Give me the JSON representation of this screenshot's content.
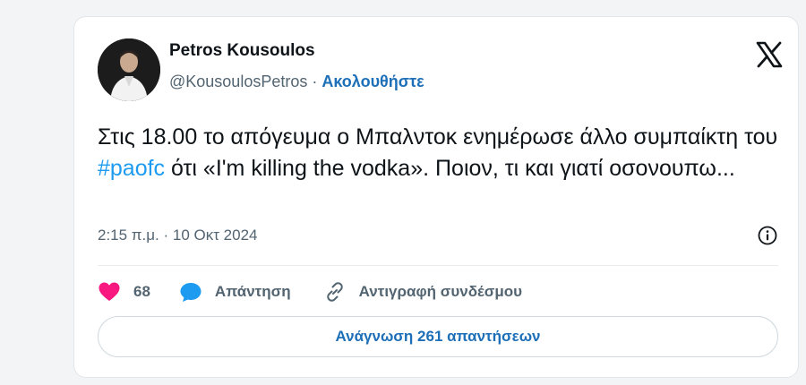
{
  "author": {
    "name": "Petros Kousoulos",
    "handle": "@KousoulosPetros",
    "separator": " · ",
    "follow_label": "Ακολουθήστε"
  },
  "tweet": {
    "text_before": "Στις 18.00 το απόγευμα ο Μπαλντοκ ενημέρωσε άλλο συμπαίκτη του ",
    "hashtag": "#paofc",
    "text_after": " ότι «I'm killing the vodka». Ποιον, τι και γιατί οσονουπω...",
    "timestamp": "2:15 π.μ. · 10 Οκτ 2024"
  },
  "actions": {
    "like_count": "68",
    "reply_label": "Απάντηση",
    "copy_label": "Αντιγραφή συνδέσμου"
  },
  "read_replies_label": "Ανάγνωση 261 απαντήσεων",
  "colors": {
    "heart": "#f91880",
    "reply_bubble": "#1d9bf0",
    "link_blue": "#1d6fb8",
    "hashtag": "#1d9bf0"
  },
  "icons": [
    "x-logo-icon",
    "info-icon",
    "heart-icon",
    "reply-bubble-icon",
    "link-icon"
  ]
}
